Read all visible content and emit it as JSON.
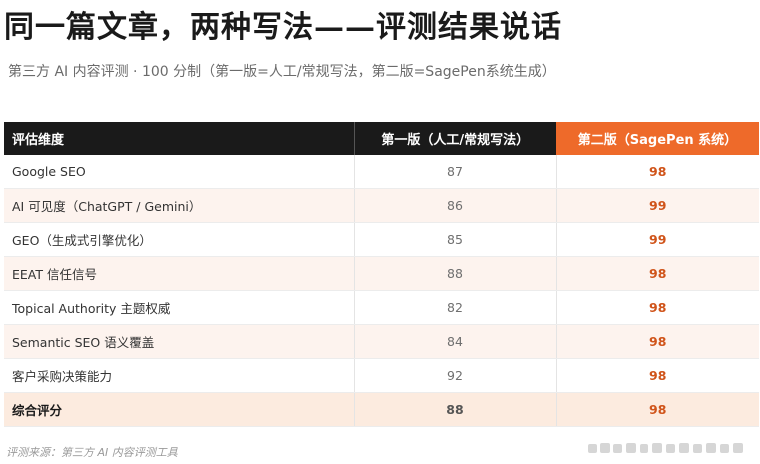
{
  "title": "同一篇文章，两种写法——评测结果说话",
  "subtitle": "第三方 AI 内容评测 · 100 分制（第一版=人工/常规写法，第二版=SagePen系统生成）",
  "table": {
    "headers": [
      "评估维度",
      "第一版（人工/常规写法）",
      "第二版（SagePen 系统）"
    ],
    "rows": [
      {
        "dimension": "Google SEO",
        "v1": "87",
        "v2": "98"
      },
      {
        "dimension": "AI 可见度（ChatGPT / Gemini）",
        "v1": "86",
        "v2": "99"
      },
      {
        "dimension": "GEO（生成式引擎优化）",
        "v1": "85",
        "v2": "99"
      },
      {
        "dimension": "EEAT 信任信号",
        "v1": "88",
        "v2": "98"
      },
      {
        "dimension": "Topical Authority 主题权威",
        "v1": "82",
        "v2": "98"
      },
      {
        "dimension": "Semantic SEO 语义覆盖",
        "v1": "84",
        "v2": "98"
      },
      {
        "dimension": "客户采购决策能力",
        "v1": "92",
        "v2": "98"
      },
      {
        "dimension": "综合评分",
        "v1": "88",
        "v2": "98"
      }
    ]
  },
  "source": "评测来源：第三方 AI 内容评测工具",
  "colors": {
    "accent": "#ee6a2a",
    "header_dark": "#1a1a1a",
    "v2_text": "#d0541a"
  }
}
